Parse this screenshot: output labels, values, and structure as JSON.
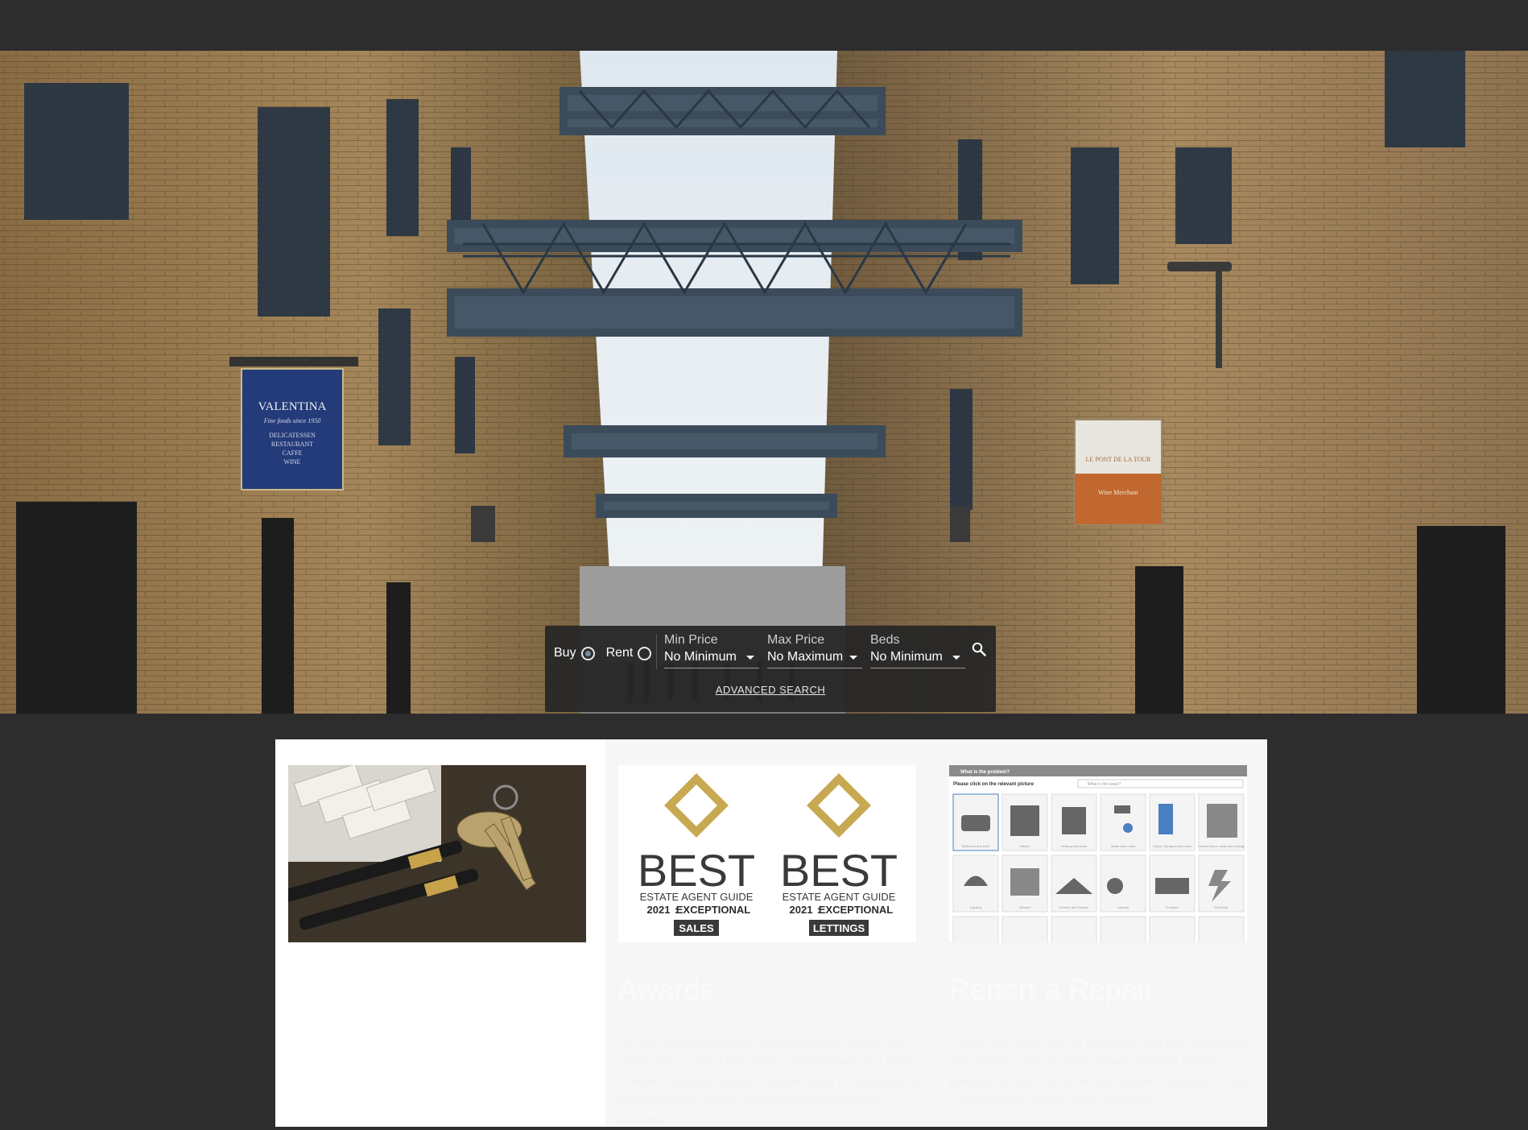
{
  "search": {
    "buy_label": "Buy",
    "rent_label": "Rent",
    "selected_mode": "Buy",
    "min_price_label": "Min Price",
    "min_price_value": "No Minimum",
    "max_price_label": "Max Price",
    "max_price_value": "No Maximum",
    "beds_label": "Beds",
    "beds_value": "No Minimum",
    "advanced_link": "ADVANCED SEARCH",
    "search_icon": "search-icon"
  },
  "hero": {
    "sign_left_title": "VALENTINA",
    "sign_left_sub": "Fine foods since 1950",
    "sign_left_lines": [
      "DELICATESSEN",
      "RESTAURANT",
      "CAFFE",
      "WINE"
    ],
    "sign_right_title": "LE PONT DE LA TOUR",
    "sign_right_sub": "Wine Merchant"
  },
  "cards": [
    {
      "title": "",
      "text": ""
    },
    {
      "title": "Awards",
      "text": "We are delighted that the professionalism of each and every one our team has been acknowledged by a range of awards and accolades in recent years for outstanding performance in Sales, Lettings and Management services.",
      "badges": [
        {
          "word": "BEST",
          "line1": "ESTATE AGENT GUIDE",
          "year": "2021",
          "grade": "EXCEPTIONAL",
          "tag": "SALES"
        },
        {
          "word": "BEST",
          "line1": "ESTATE AGENT GUIDE",
          "year": "2021",
          "grade": "EXCEPTIONAL",
          "tag": "LETTINGS"
        }
      ]
    },
    {
      "title": "Report a Repair",
      "text": "A quick and easy way for tenants to flag any issues with their homes, with an online repair reporting system powered by FIXFLO so we can deliver a speedy fix from a qualified and trusted local contractor.",
      "screenshot": {
        "header": "What is the problem?",
        "prompt": "Please click on the relevant picture",
        "search_placeholder": "What is the issue?",
        "tiles": [
          "Bathroom and toilet",
          "Kitchen",
          "Heating and boiler",
          "Water and Leaks",
          "Doors, Garages and Locks",
          "Internal floors, walls and ceilings",
          "Lighting",
          "Window",
          "Exterior and Garden",
          "Laundry",
          "Furniture",
          "Electricity"
        ]
      }
    }
  ],
  "colors": {
    "page_bg": "#2d2d2d",
    "panel_bg": "#262626",
    "gold": "#c8a951",
    "badge_text": "#3a3a3a"
  }
}
